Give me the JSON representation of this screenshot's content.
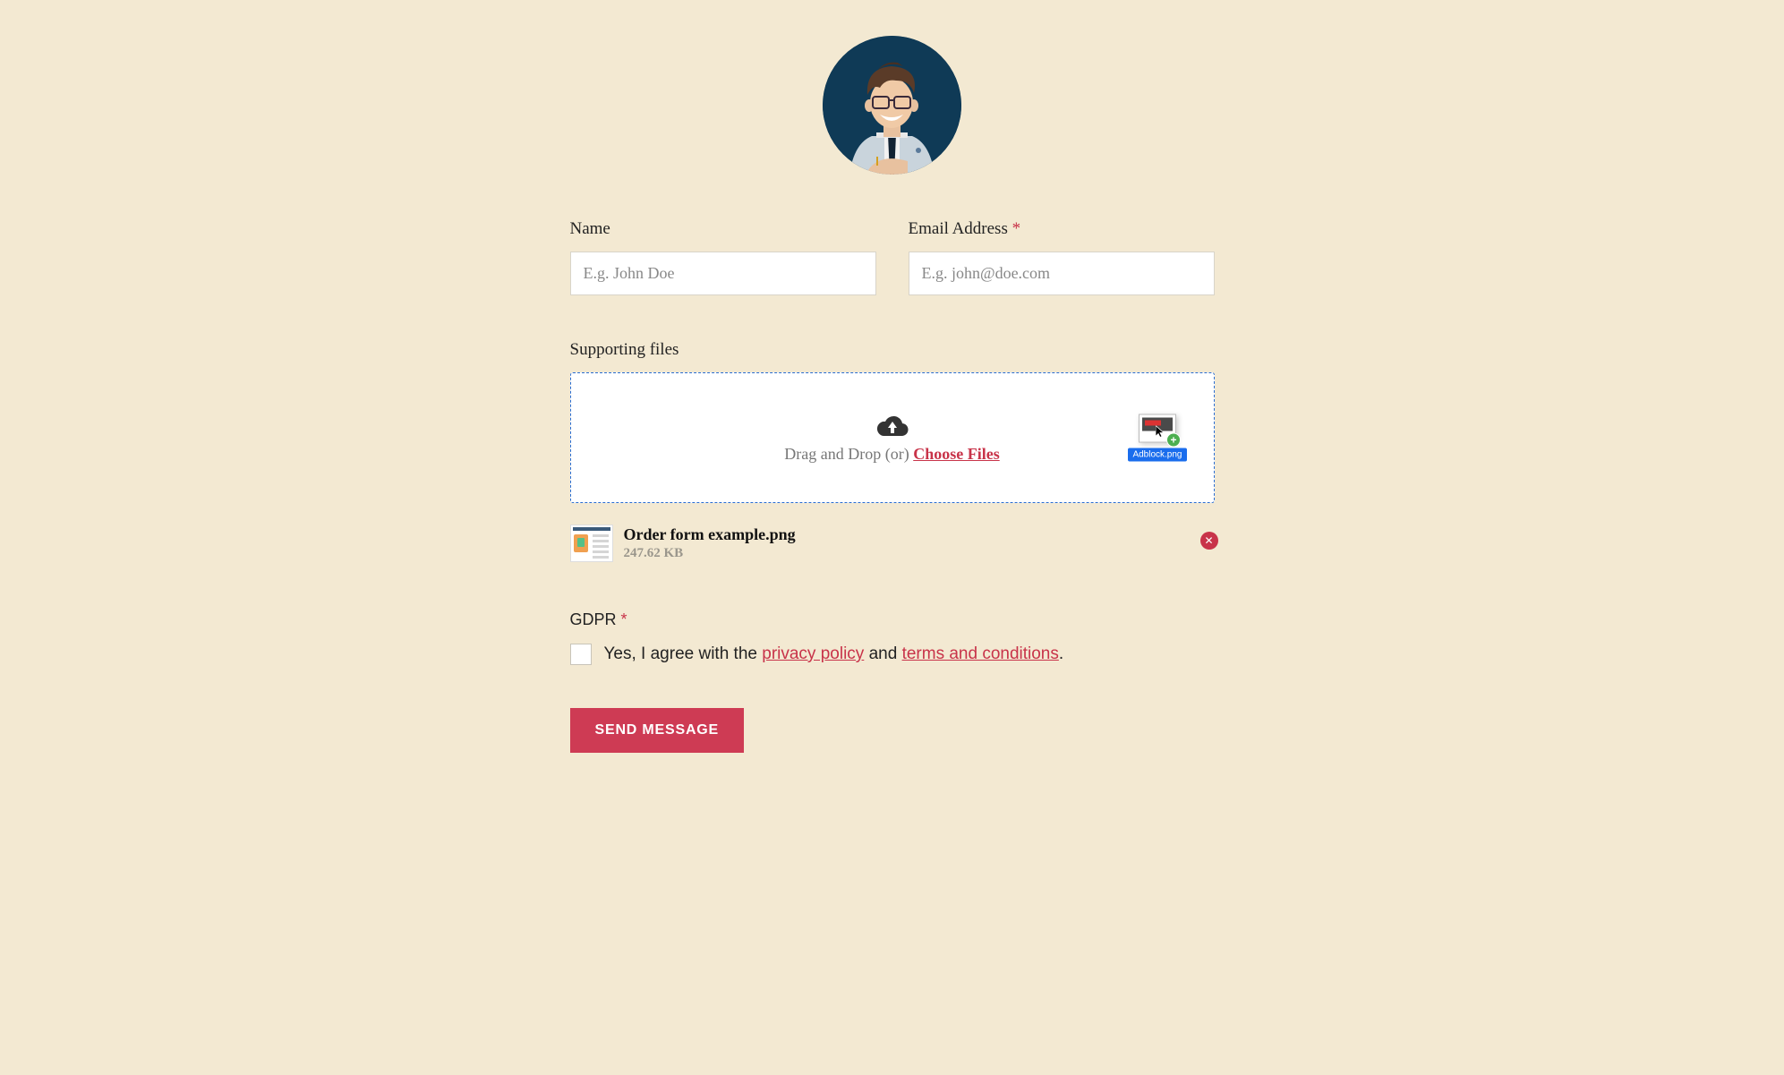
{
  "form": {
    "name": {
      "label": "Name",
      "placeholder": "E.g. John Doe",
      "value": ""
    },
    "email": {
      "label": "Email Address",
      "placeholder": "E.g. john@doe.com",
      "value": "",
      "required_mark": "*"
    }
  },
  "upload": {
    "label": "Supporting files",
    "drop_text": "Drag and Drop (or) ",
    "choose_text": "Choose Files",
    "drag_ghost_filename": "Adblock.png"
  },
  "file": {
    "name": "Order form example.png",
    "size": "247.62 KB",
    "remove_glyph": "✕"
  },
  "gdpr": {
    "label": "GDPR",
    "required_mark": "*",
    "text_prefix": "Yes, I agree with the ",
    "link_privacy": "privacy policy",
    "text_mid": " and ",
    "link_terms": "terms and conditions",
    "text_suffix": "."
  },
  "submit": {
    "label": "SEND MESSAGE"
  }
}
